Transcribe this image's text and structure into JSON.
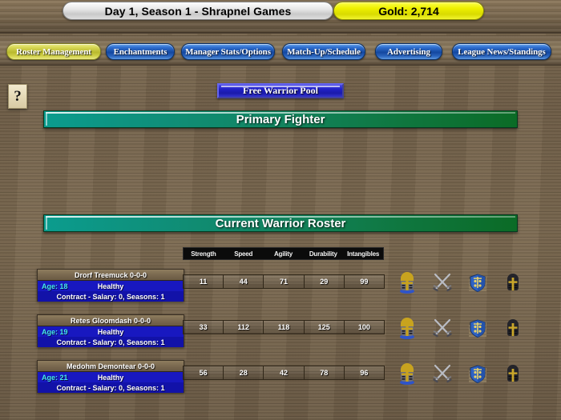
{
  "header": {
    "title": "Day 1, Season 1 - Shrapnel Games",
    "gold_label": "Gold: 2,714"
  },
  "nav": {
    "items": [
      {
        "label": "Roster Management",
        "active": true
      },
      {
        "label": "Enchantments",
        "active": false
      },
      {
        "label": "Manager Stats/Options",
        "active": false
      },
      {
        "label": "Match-Up/Schedule",
        "active": false
      },
      {
        "label": "Advertising",
        "active": false
      },
      {
        "label": "League News/Standings",
        "active": false
      }
    ]
  },
  "help": {
    "glyph": "?"
  },
  "pool_button": {
    "label": "Free Warrior Pool"
  },
  "banners": {
    "primary_fighter": "Primary Fighter",
    "current_warrior_roster": "Current Warrior Roster"
  },
  "stat_columns": [
    "Strength",
    "Speed",
    "Agility",
    "Durability",
    "Intangibles"
  ],
  "roster": [
    {
      "name": "Drorf Treemuck  0-0-0",
      "age": "Age: 18",
      "status": "Healthy",
      "contract": "Contract - Salary: 0, Seasons: 1",
      "stats": [
        "11",
        "44",
        "71",
        "29",
        "99"
      ]
    },
    {
      "name": "Retes Gloomdash  0-0-0",
      "age": "Age: 19",
      "status": "Healthy",
      "contract": "Contract - Salary: 0, Seasons: 1",
      "stats": [
        "33",
        "112",
        "118",
        "125",
        "100"
      ]
    },
    {
      "name": "Medohm Demontear  0-0-0",
      "age": "Age: 21",
      "status": "Healthy",
      "contract": "Contract - Salary: 0, Seasons: 1",
      "stats": [
        "56",
        "28",
        "42",
        "78",
        "96"
      ]
    }
  ],
  "row_actions": [
    {
      "icon": "helmet-icon"
    },
    {
      "icon": "crossed-swords-icon"
    },
    {
      "icon": "shield-castle-icon"
    },
    {
      "icon": "dark-helmet-icon"
    }
  ],
  "colors": {
    "accent_blue": "#14479f",
    "active_yellow": "#b9b92d",
    "banner_teal": "#0b9c8e",
    "banner_green": "#0b6b26",
    "card_blue": "#1818c0",
    "age_cyan": "#46e8f0",
    "gold_plate": "#eef000"
  }
}
